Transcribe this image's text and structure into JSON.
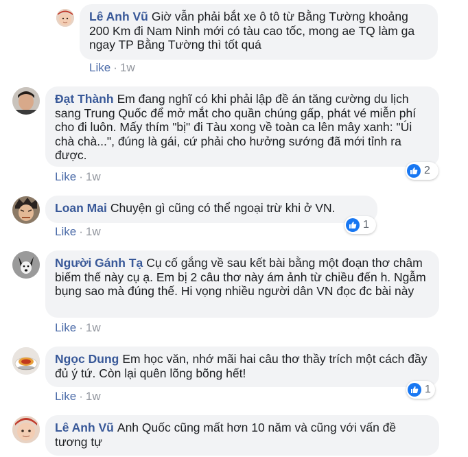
{
  "comments": [
    {
      "author": "Lê Anh Vũ",
      "text": "Giờ vẫn phải bắt xe ô tô từ Bằng Tường khoảng 200 Km đi Nam Ninh mới có tàu cao tốc, mong ae TQ làm ga ngay TP Bằng Tường thì tốt quá",
      "like_label": "Like",
      "time": "1w",
      "avatar": "baby-avatar"
    },
    {
      "author": "Đạt Thành",
      "text": "Em đang nghĩ có khi phải lập đề án tăng cường du lịch sang Trung Quốc để mở mắt cho quần chúng gấp, phát vé miễn phí cho đi luôn. Mấy thím \"bị\" đi Tàu xong về toàn ca lên mây xanh: \"Úi chà chà...\", đúng là gái, cứ phải cho hưởng sướng đã mới tỉnh ra được.",
      "like_label": "Like",
      "time": "1w",
      "reactions": "2",
      "avatar": "man-avatar"
    },
    {
      "author": "Loan Mai",
      "text": "Chuyện gì cũng có thể ngoại trừ khi ở VN.",
      "like_label": "Like",
      "time": "1w",
      "reactions": "1",
      "avatar": "cartoon-avatar"
    },
    {
      "author": "Người Gánh Tạ",
      "text": "Cụ cố gắng về sau kết bài bằng một đoạn thơ châm biếm thế này cụ ạ. Em bị 2 câu thơ này ám ảnh từ chiều đến h. Ngẫm bụng sao mà đúng thế. Hi vọng nhiều người dân VN đọc đc bài này",
      "like_label": "Like",
      "time": "1w",
      "avatar": "dog-avatar"
    },
    {
      "author": "Ngọc Dung",
      "text": "Em học văn, nhớ mãi hai câu thơ thầy trích một cách đầy đủ ý tứ. Còn lại quên lõng bõng hết!",
      "like_label": "Like",
      "time": "1w",
      "reactions": "1",
      "avatar": "food-avatar"
    },
    {
      "author": "Lê Anh Vũ",
      "text": "Anh Quốc cũng mất hơn 10 năm và cũng với vấn đề tương tự",
      "avatar": "baby-avatar"
    }
  ],
  "colors": {
    "author": "#385898",
    "bubble": "#f2f3f5",
    "like_link": "#4b6ba8",
    "meta": "#90949c",
    "reaction": "#1877f2"
  }
}
